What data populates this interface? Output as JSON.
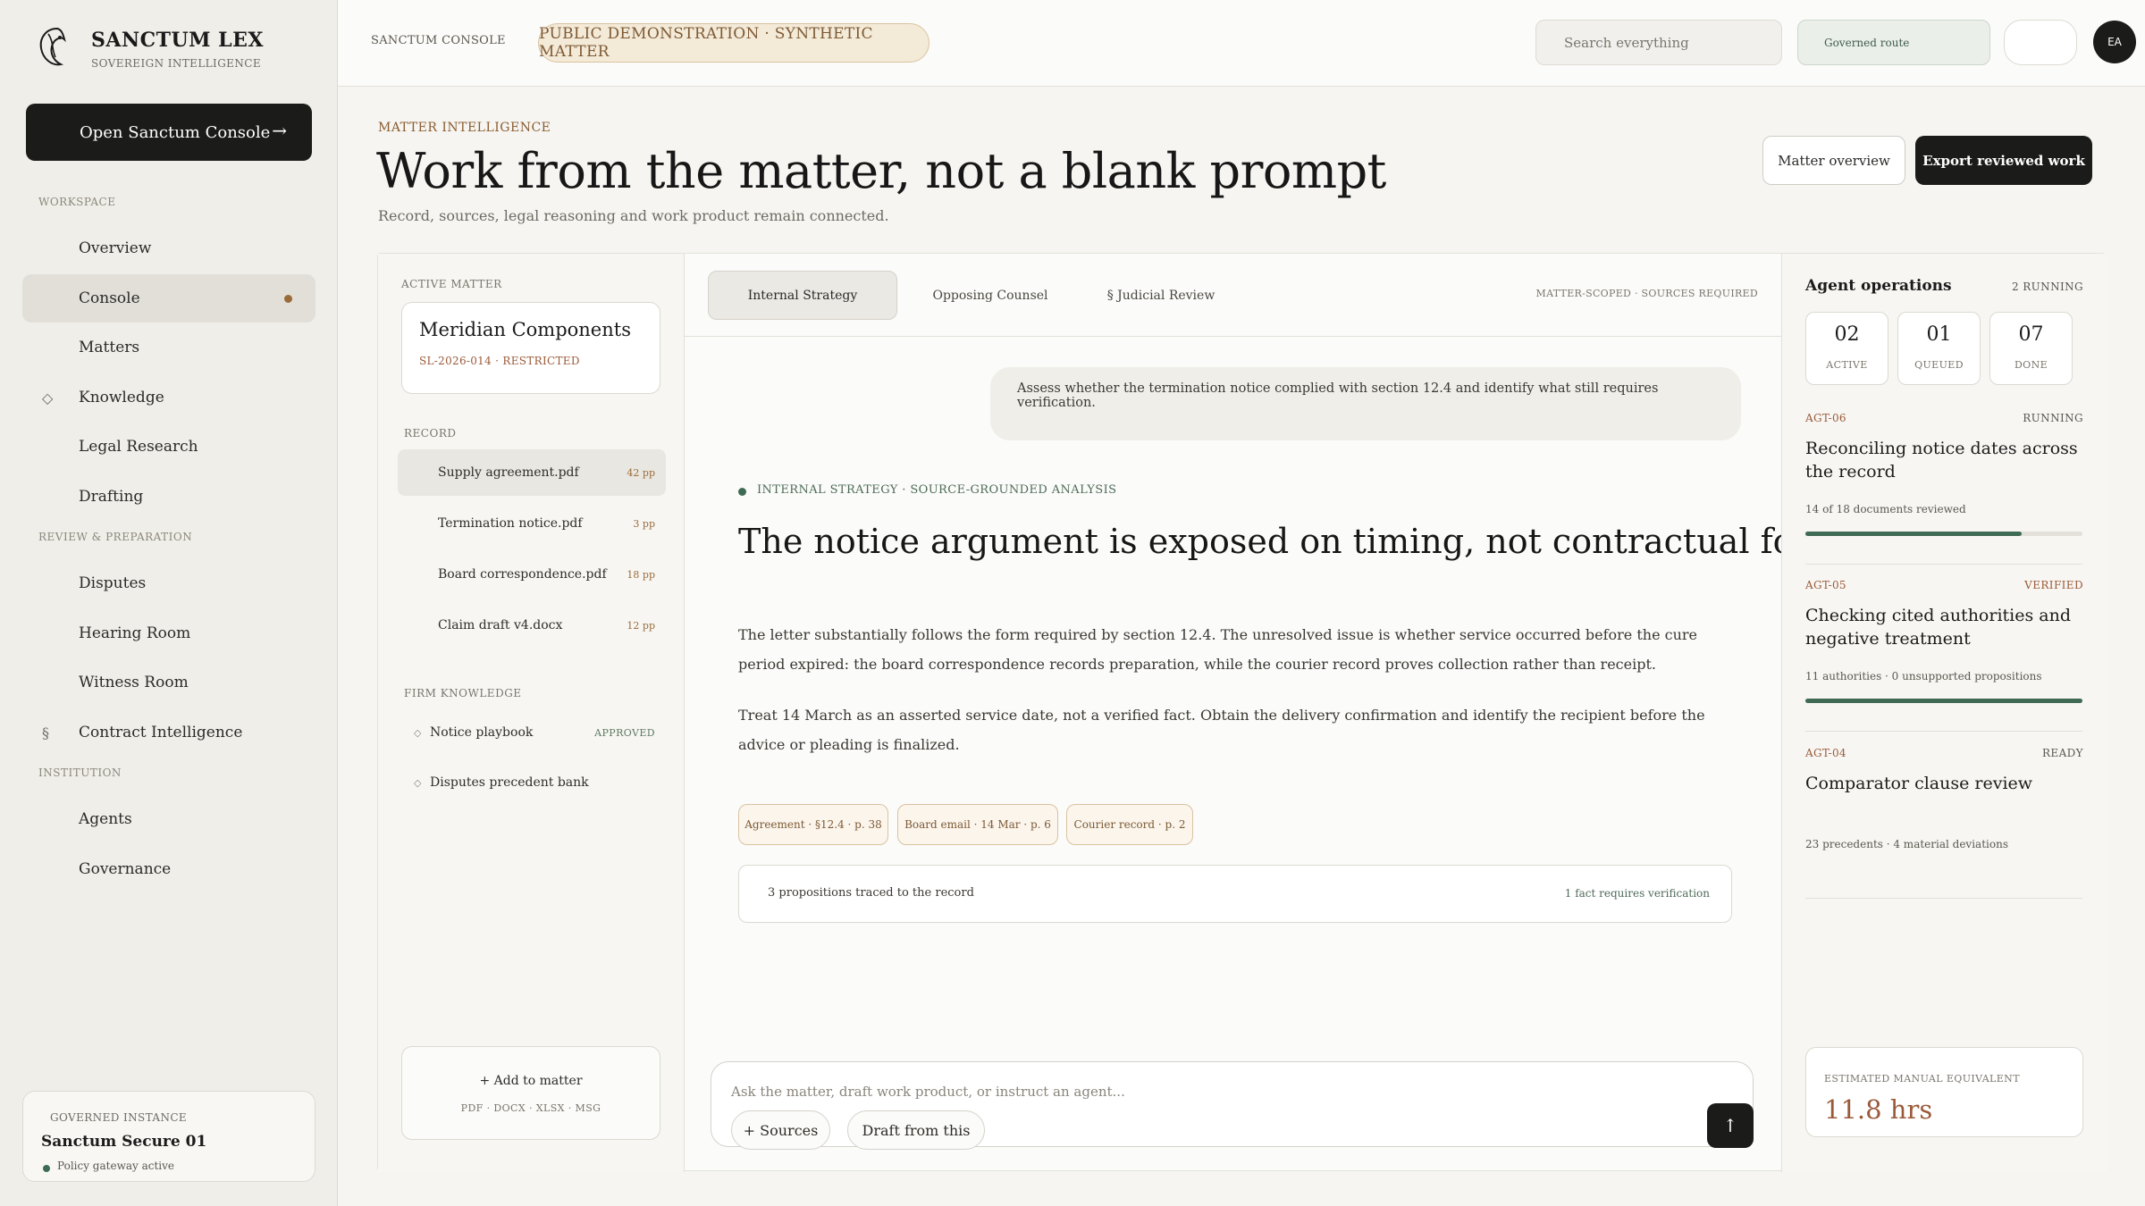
{
  "brand": {
    "name": "SANCTUM LEX",
    "sub": "SOVEREIGN INTELLIGENCE",
    "open_label": "Open Sanctum Console",
    "open_arrow": "→"
  },
  "nav": {
    "workspace_label": "WORKSPACE",
    "review_label": "REVIEW & PREPARATION",
    "institution_label": "INSTITUTION",
    "items": [
      {
        "label": "Overview"
      },
      {
        "label": "Console"
      },
      {
        "label": "Matters"
      },
      {
        "label": "Knowledge",
        "icon": "◇"
      },
      {
        "label": "Legal Research"
      },
      {
        "label": "Drafting"
      },
      {
        "label": "Disputes"
      },
      {
        "label": "Hearing Room"
      },
      {
        "label": "Witness Room"
      },
      {
        "label": "Contract Intelligence",
        "icon": "§"
      },
      {
        "label": "Agents"
      },
      {
        "label": "Governance"
      }
    ]
  },
  "instance": {
    "label": "GOVERNED INSTANCE",
    "name": "Sanctum Secure 01",
    "status": "Policy gateway active",
    "status_color": "#3f6b54"
  },
  "topbar": {
    "console_label": "SANCTUM CONSOLE",
    "demo_pill": "PUBLIC DEMONSTRATION · SYNTHETIC MATTER",
    "search_placeholder": "Search everything",
    "route_label": "Governed route",
    "avatar": "EA"
  },
  "header": {
    "eyebrow": "MATTER INTELLIGENCE",
    "title": "Work from the matter, not a blank prompt",
    "subtitle": "Record, sources, legal reasoning and work product remain connected.",
    "overview_btn": "Matter overview",
    "export_btn": "Export reviewed work"
  },
  "left": {
    "active_label": "ACTIVE MATTER",
    "matter_name": "Meridian Components",
    "matter_code": "SL-2026-014 · RESTRICTED",
    "record_label": "RECORD",
    "records": [
      {
        "name": "Supply agreement.pdf",
        "pages": "42 pp"
      },
      {
        "name": "Termination notice.pdf",
        "pages": "3 pp"
      },
      {
        "name": "Board correspondence.pdf",
        "pages": "18 pp"
      },
      {
        "name": "Claim draft v4.docx",
        "pages": "12 pp"
      }
    ],
    "fk_label": "FIRM KNOWLEDGE",
    "fk": [
      {
        "name": "Notice playbook",
        "badge": "APPROVED"
      },
      {
        "name": "Disputes precedent bank",
        "badge": ""
      }
    ],
    "add_label": "+  Add to matter",
    "add_types": "PDF · DOCX · XLSX · MSG"
  },
  "center": {
    "tabs": [
      {
        "label": "Internal Strategy"
      },
      {
        "label": "Opposing Counsel"
      },
      {
        "label": "§  Judicial Review"
      }
    ],
    "tab_meta": "MATTER-SCOPED · SOURCES REQUIRED",
    "user_message": "Assess whether the termination notice complied with section 12.4 and identify what still requires verification.",
    "analysis_label": "INTERNAL STRATEGY · SOURCE-GROUNDED ANALYSIS",
    "answer_title": "The notice argument is exposed on timing, not contractual form.",
    "answer_p1": "The letter substantially follows the form required by section 12.4. The unresolved issue is whether service occurred before the cure period expired: the board correspondence records preparation, while the courier record proves collection rather than receipt.",
    "answer_p2": "Treat 14 March as an asserted service date, not a verified fact. Obtain the delivery confirmation and identify the recipient before the advice or pleading is finalized.",
    "citations": [
      {
        "label": "Agreement · §12.4 · p. 38"
      },
      {
        "label": "Board email · 14 Mar · p. 6"
      },
      {
        "label": "Courier record · p. 2"
      }
    ],
    "trace_left": "3 propositions traced to the record",
    "trace_right": "1 fact requires verification",
    "composer_placeholder": "Ask the matter, draft work product, or instruct an agent...",
    "chip_sources": "+ Sources",
    "chip_draft": "Draft from this",
    "send_icon": "↑"
  },
  "right": {
    "title": "Agent operations",
    "running": "2 RUNNING",
    "stats": [
      {
        "num": "02",
        "label": "ACTIVE"
      },
      {
        "num": "01",
        "label": "QUEUED"
      },
      {
        "num": "07",
        "label": "DONE"
      }
    ],
    "agents": [
      {
        "id": "AGT-06",
        "status": "RUNNING",
        "title": "Reconciling notice dates across the record",
        "meta": "14 of 18 documents reviewed",
        "progress": 0.78
      },
      {
        "id": "AGT-05",
        "status": "VERIFIED",
        "title": "Checking cited authorities and negative treatment",
        "meta": "11 authorities · 0 unsupported propositions",
        "progress": 1.0
      },
      {
        "id": "AGT-04",
        "status": "READY",
        "title": "Comparator clause review",
        "meta": "23 precedents · 4 material deviations",
        "progress": null
      }
    ],
    "est_label": "ESTIMATED MANUAL EQUIVALENT",
    "est_value": "11.8 hrs"
  },
  "colors": {
    "accent": "#9a5a3a",
    "ink": "#1b1b19",
    "green": "#3f6b54"
  }
}
